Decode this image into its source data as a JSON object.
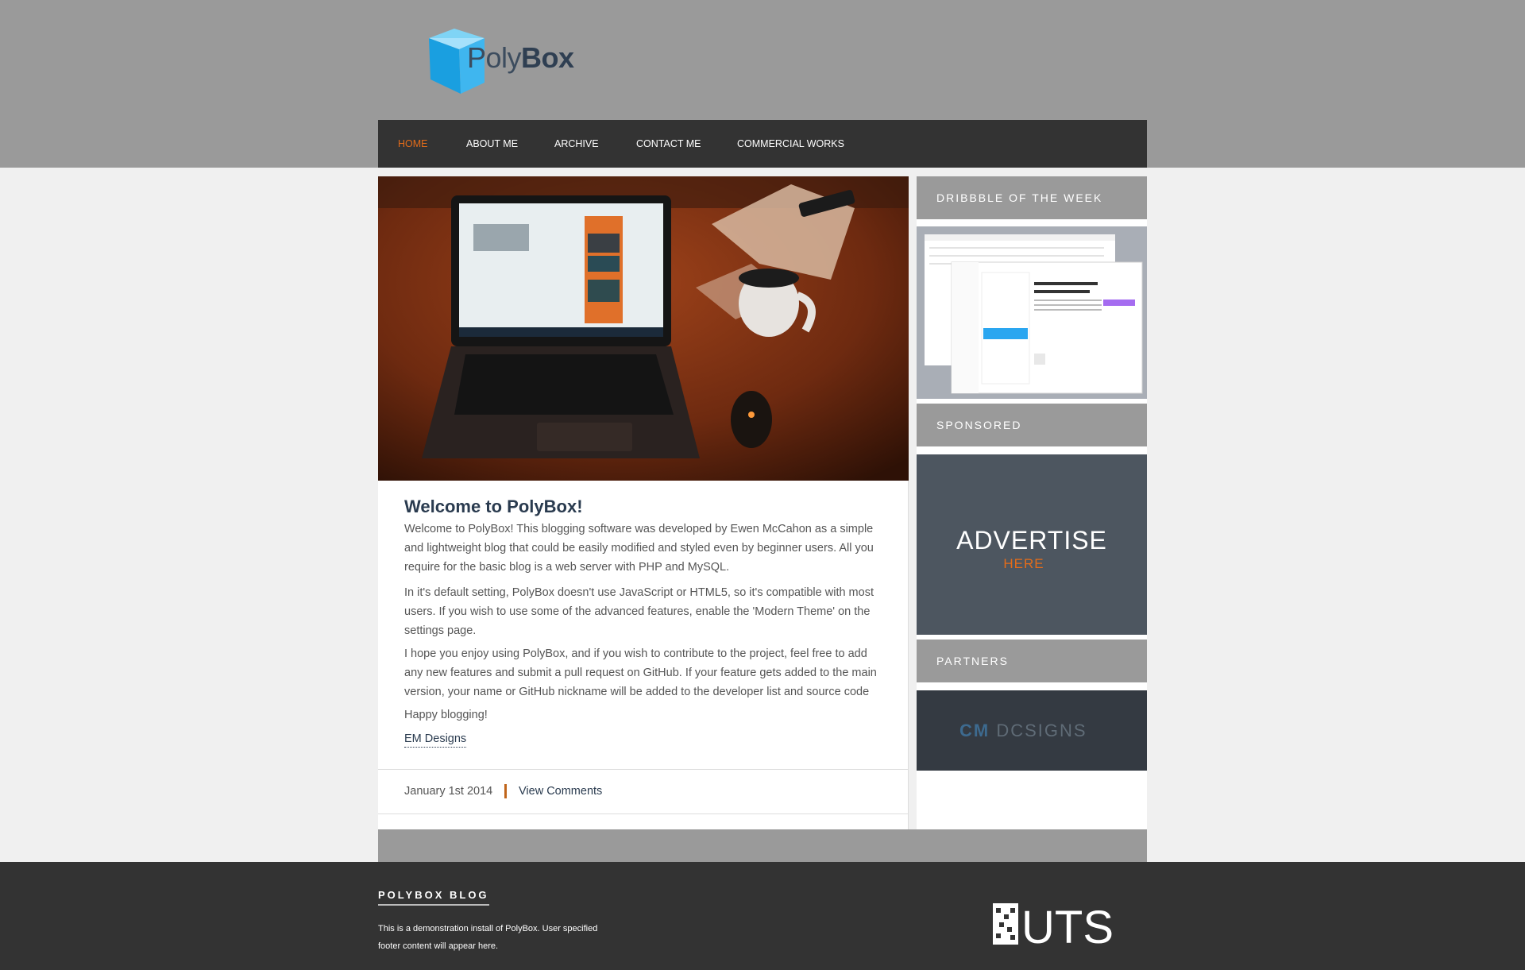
{
  "brand": {
    "logo_text_light": "Poly",
    "logo_text_bold": "Box"
  },
  "nav": {
    "items": [
      {
        "label": "HOME",
        "active": true
      },
      {
        "label": "ABOUT ME",
        "active": false
      },
      {
        "label": "ARCHIVE",
        "active": false
      },
      {
        "label": "CONTACT ME",
        "active": false
      },
      {
        "label": "COMMERCIAL WORKS",
        "active": false
      }
    ]
  },
  "post": {
    "title": "Welcome to PolyBox!",
    "paragraphs": [
      "Welcome to PolyBox! This blogging software was developed by Ewen McCahon as a simple and lightweight blog that could be easily modified and styled even by beginner users. All you require for the basic blog is a web server with PHP and MySQL.",
      "In it's default setting, PolyBox doesn't use JavaScript or HTML5, so it's compatible with most users. If you wish to use some of the advanced features, enable the 'Modern Theme' on the settings page.",
      "I hope you enjoy using PolyBox, and if you wish to contribute to the project, feel free to add any new features and submit a pull request on GitHub. If your feature gets added to the main version, your name or GitHub nickname will be added to the developer list and source code",
      "Happy blogging!"
    ],
    "link_text": "EM Designs",
    "date": "January 1st 2014",
    "comments_link": "View Comments"
  },
  "sidebar": {
    "dribbble_heading": "DRIBBBLE OF THE WEEK",
    "sponsored_heading": "SPONSORED",
    "advert_line1": "ADVERTISE",
    "advert_line2": "HERE",
    "partners_heading": "PARTNERS",
    "partner_name_a": "CM",
    "partner_name_b": "DCSIGNS"
  },
  "footer": {
    "title": "POLYBOX BLOG",
    "text": "This is a demonstration install of PolyBox. User specified footer content will appear here.",
    "logo_text": "UTS"
  },
  "colors": {
    "accent": "#e36c1a",
    "nav_bg": "#333333",
    "band_gray": "#9a9a9a",
    "title_navy": "#2a3b4f"
  }
}
